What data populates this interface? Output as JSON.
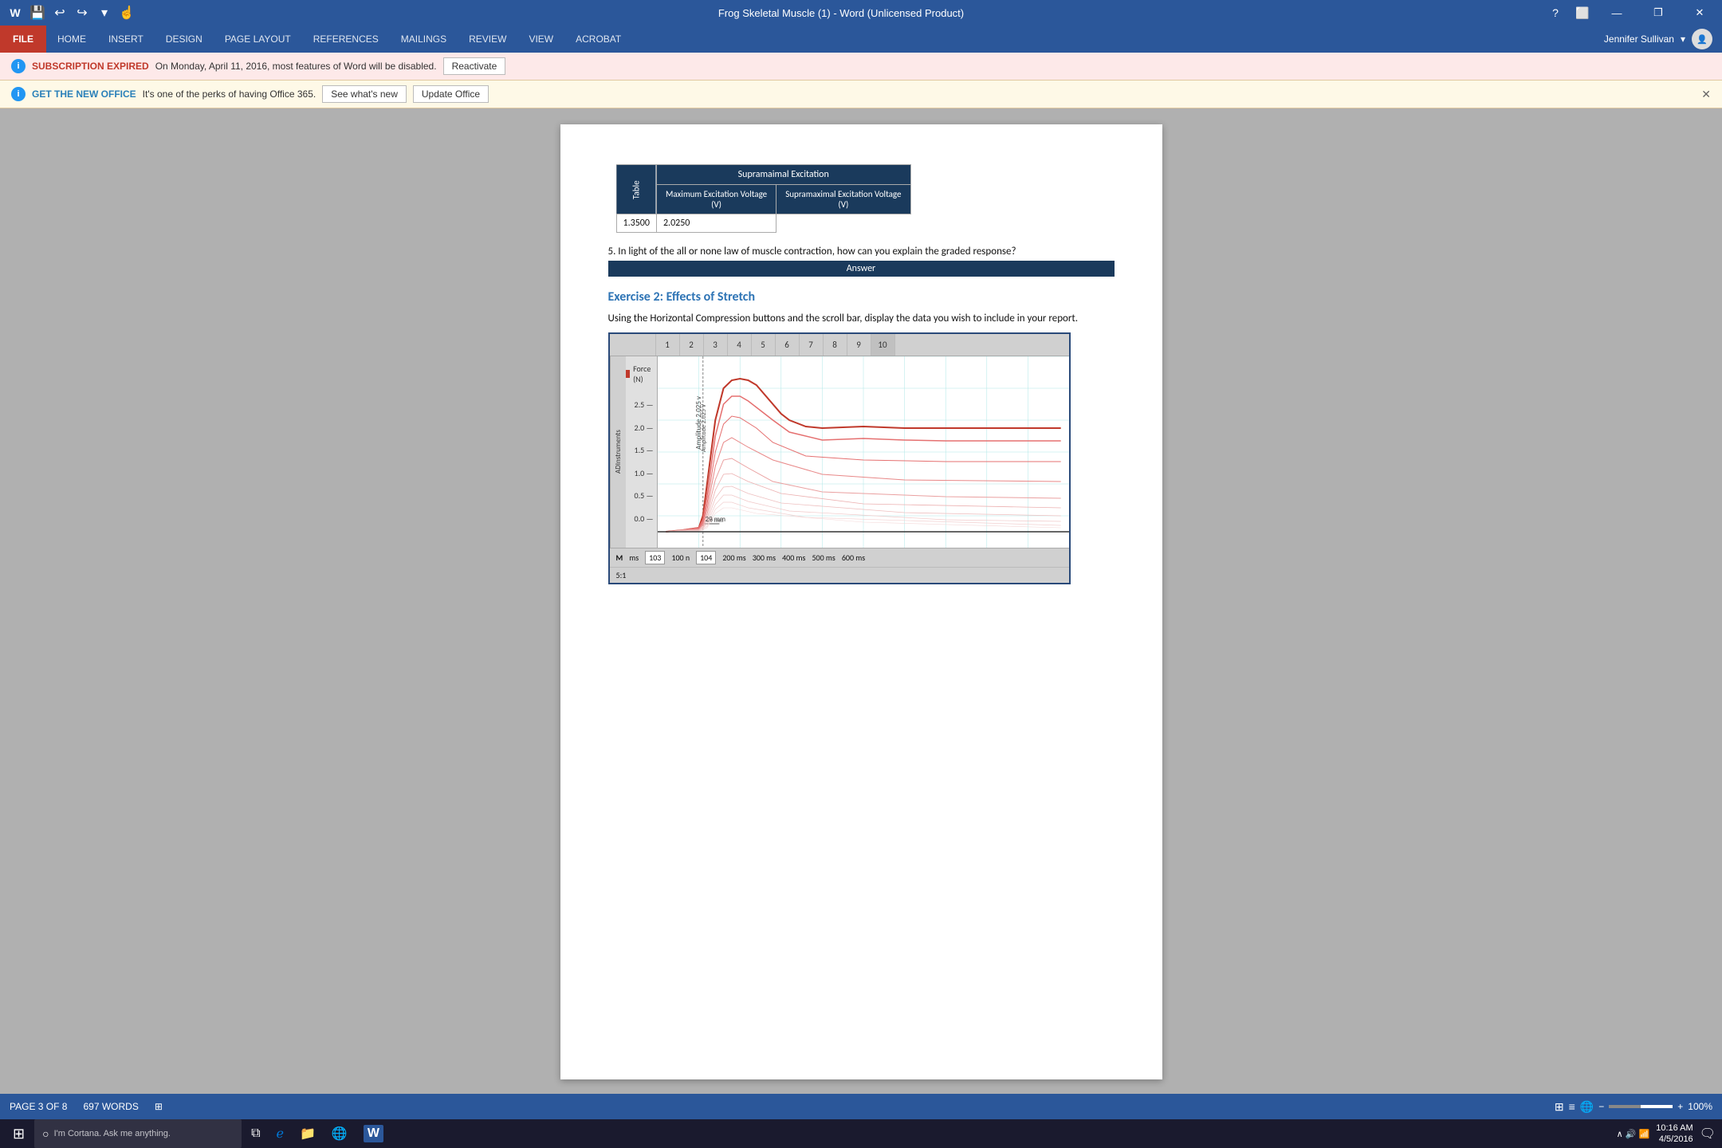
{
  "titlebar": {
    "title": "Frog Skeletal Muscle (1) - Word (Unlicensed Product)",
    "min_btn": "—",
    "restore_btn": "❐",
    "close_btn": "✕"
  },
  "ribbon": {
    "tabs": [
      "FILE",
      "HOME",
      "INSERT",
      "DESIGN",
      "PAGE LAYOUT",
      "REFERENCES",
      "MAILINGS",
      "REVIEW",
      "VIEW",
      "ACROBAT"
    ],
    "active": "FILE",
    "user": "Jennifer Sullivan"
  },
  "notifications": {
    "subscription": {
      "icon": "i",
      "label": "SUBSCRIPTION EXPIRED",
      "text": "On Monday, April 11, 2016, most features of Word will be disabled.",
      "button": "Reactivate"
    },
    "office": {
      "icon": "i",
      "label": "GET THE NEW OFFICE",
      "text": "It's one of the perks of having Office 365.",
      "btn1": "See what's new",
      "btn2": "Update Office"
    }
  },
  "document": {
    "table": {
      "title": "Supramaimal  Excitation",
      "side_label": "Table",
      "col1_header": "Maximum Excitation Voltage (V)",
      "col2_header": "Supramaximal Excitation Voltage (V)",
      "row1_col1": "1.3500",
      "row1_col2": "2.0250"
    },
    "question5": "5.   In light of the all or none law of muscle contraction, how can you explain the graded response?",
    "answer_label": "Answer",
    "exercise2_heading": "Exercise 2: Effects of Stretch",
    "instruction": "Using the Horizontal Compression buttons and the scroll bar, display the data you wish to include in your report.",
    "chart": {
      "numbers": [
        "1",
        "2",
        "3",
        "4",
        "5",
        "6",
        "7",
        "8",
        "9",
        "10"
      ],
      "y_labels": [
        "2.5",
        "2.0",
        "1.5",
        "1.0",
        "0.5",
        "0.0"
      ],
      "side_label": "ADInstruments",
      "y_axis_label": "Force (N)",
      "x_annotations": [
        "Amplitude 2.025 v",
        "29 mm"
      ],
      "footer_items": [
        "M",
        "ms",
        "103",
        "100 n",
        "104",
        "200 ms",
        "300 ms",
        "400 ms",
        "500 ms",
        "600 ms"
      ],
      "scale": "5:1"
    }
  },
  "statusbar": {
    "page_info": "PAGE 3 OF 8",
    "word_count": "697 WORDS",
    "view_icon": "⊞"
  },
  "taskbar": {
    "start_icon": "⊞",
    "cortana_text": "I'm Cortana. Ask me anything.",
    "time": "10:16 AM",
    "date": "4/5/2016",
    "zoom_level": "100%",
    "zoom_minus": "−",
    "zoom_plus": "+"
  }
}
